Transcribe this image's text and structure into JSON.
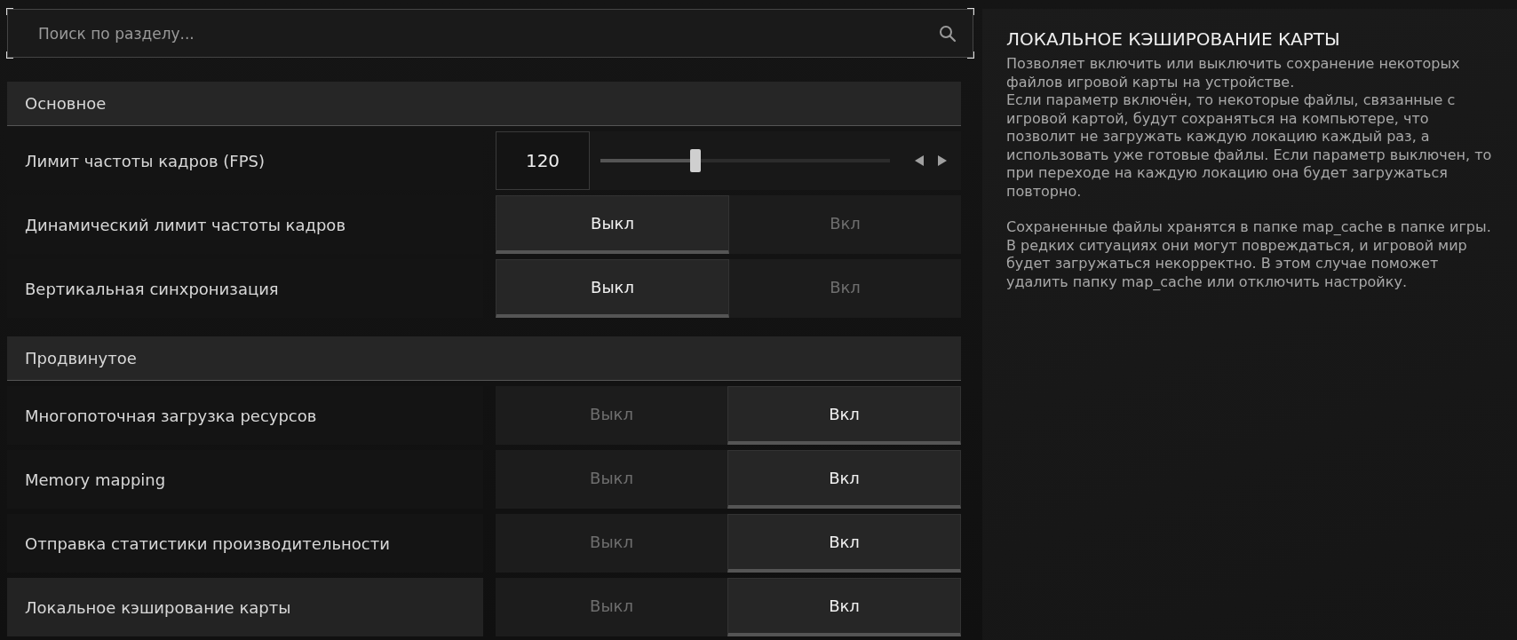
{
  "search": {
    "placeholder": "Поиск по разделу..."
  },
  "sections": [
    {
      "title": "Основное",
      "rows": [
        {
          "kind": "slider",
          "label": "Лимит частоты кадров (FPS)",
          "selected": false,
          "value": "120",
          "level": 0.33
        },
        {
          "kind": "toggle",
          "label": "Динамический лимит частоты кадров",
          "selected": false,
          "options": [
            {
              "label": "Выкл",
              "selected": true
            },
            {
              "label": "Вкл",
              "selected": false
            }
          ]
        },
        {
          "kind": "toggle",
          "label": "Вертикальная синхронизация",
          "selected": false,
          "options": [
            {
              "label": "Выкл",
              "selected": true
            },
            {
              "label": "Вкл",
              "selected": false
            }
          ]
        }
      ]
    },
    {
      "title": "Продвинутое",
      "rows": [
        {
          "kind": "toggle",
          "label": "Многопоточная загрузка ресурсов",
          "selected": false,
          "options": [
            {
              "label": "Выкл",
              "selected": false
            },
            {
              "label": "Вкл",
              "selected": true
            }
          ]
        },
        {
          "kind": "toggle",
          "label": "Memory mapping",
          "selected": false,
          "options": [
            {
              "label": "Выкл",
              "selected": false
            },
            {
              "label": "Вкл",
              "selected": true
            }
          ]
        },
        {
          "kind": "toggle",
          "label": "Отправка статистики производительности",
          "selected": false,
          "options": [
            {
              "label": "Выкл",
              "selected": false
            },
            {
              "label": "Вкл",
              "selected": true
            }
          ]
        },
        {
          "kind": "toggle",
          "label": "Локальное кэширование карты",
          "selected": true,
          "options": [
            {
              "label": "Выкл",
              "selected": false
            },
            {
              "label": "Вкл",
              "selected": true
            }
          ]
        }
      ]
    }
  ],
  "help": {
    "title": "ЛОКАЛЬНОЕ КЭШИРОВАНИЕ КАРТЫ",
    "paragraphs": [
      "Позволяет включить или выключить сохранение некоторых файлов игровой карты на устройстве.",
      "Если параметр включён, то некоторые файлы, связанные с игровой картой, будут сохраняться на компьютере, что позволит не загружать каждую локацию каждый раз, а использовать уже готовые файлы. Если параметр выключен, то при переходе на каждую локацию она будет загружаться повторно.",
      "Сохраненные файлы хранятся в папке map_cache в папке игры. В редких ситуациях они могут повреждаться, и игровой мир будет загружаться некорректно. В этом случае поможет удалить папку map_cache или отключить настройку."
    ]
  }
}
